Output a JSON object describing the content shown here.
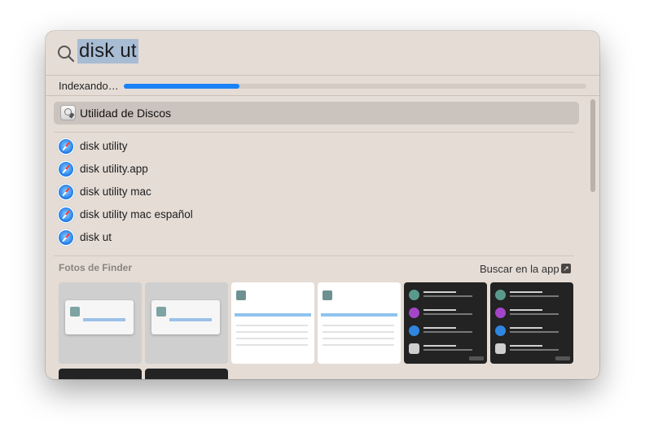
{
  "search": {
    "query": "disk ut"
  },
  "indexing": {
    "label": "Indexando…",
    "progress": 0.25
  },
  "top_hit": {
    "label": "Utilidad de Discos",
    "icon": "disk-utility-icon"
  },
  "suggestions": [
    {
      "label": "disk utility",
      "icon": "safari-icon"
    },
    {
      "label": "disk utility.app",
      "icon": "safari-icon"
    },
    {
      "label": "disk utility mac",
      "icon": "safari-icon"
    },
    {
      "label": "disk utility mac español",
      "icon": "safari-icon"
    },
    {
      "label": "disk ut",
      "icon": "safari-icon"
    }
  ],
  "photos_section": {
    "title": "Fotos de Finder",
    "open_in_app_label": "Buscar en la app"
  },
  "colors": {
    "accent": "#1a82f6",
    "panel_bg": "#e4dcd5",
    "selection": "#a8bcd4",
    "top_hit_bg": "#cbc3bd"
  }
}
